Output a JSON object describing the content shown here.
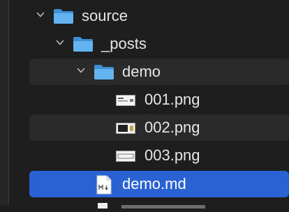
{
  "tree": {
    "items": [
      {
        "label": "source",
        "type": "folder",
        "level": 0,
        "expanded": true
      },
      {
        "label": "_posts",
        "type": "folder",
        "level": 1,
        "expanded": true
      },
      {
        "label": "demo",
        "type": "folder",
        "level": 2,
        "expanded": true
      },
      {
        "label": "001.png",
        "type": "image",
        "level": 3
      },
      {
        "label": "002.png",
        "type": "image",
        "level": 3
      },
      {
        "label": "003.png",
        "type": "image",
        "level": 3
      },
      {
        "label": "demo.md",
        "type": "markdown",
        "level": 2,
        "selected": true
      }
    ]
  },
  "colors": {
    "background": "#1e1e1e",
    "alt_row": "#2a2a2a",
    "selection": "#2a62d3",
    "folder": "#5aa9e6",
    "text": "#e6e6e6"
  },
  "icons": {
    "folder": "folder-icon",
    "image": "image-file-icon",
    "markdown": "markdown-file-icon",
    "chevron": "chevron-down-icon"
  }
}
